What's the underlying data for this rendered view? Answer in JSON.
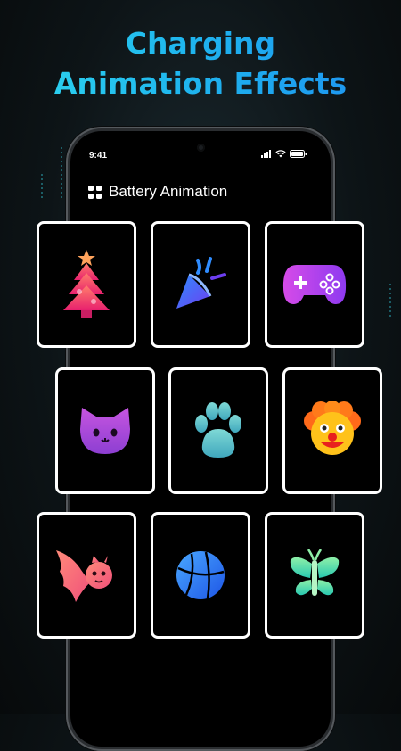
{
  "headline": {
    "line1": "Charging",
    "line2": "Animation Effects"
  },
  "status_bar": {
    "time": "9:41",
    "icons": [
      "signal-icon",
      "wifi-icon",
      "battery-icon"
    ]
  },
  "app_header": {
    "icon": "grid-icon",
    "title": "Battery Animation"
  },
  "animations": [
    {
      "icon": "christmas-tree-icon"
    },
    {
      "icon": "party-popper-icon"
    },
    {
      "icon": "gamepad-icon"
    },
    {
      "icon": "cat-icon"
    },
    {
      "icon": "paw-icon"
    },
    {
      "icon": "clown-icon"
    },
    {
      "icon": "bat-icon"
    },
    {
      "icon": "ball-icon"
    },
    {
      "icon": "butterfly-icon"
    }
  ],
  "colors": {
    "headline_gradient": [
      "#2fd8f0",
      "#1d8ff0"
    ],
    "tile_border": "#ffffff",
    "screen_bg": "#000000"
  }
}
